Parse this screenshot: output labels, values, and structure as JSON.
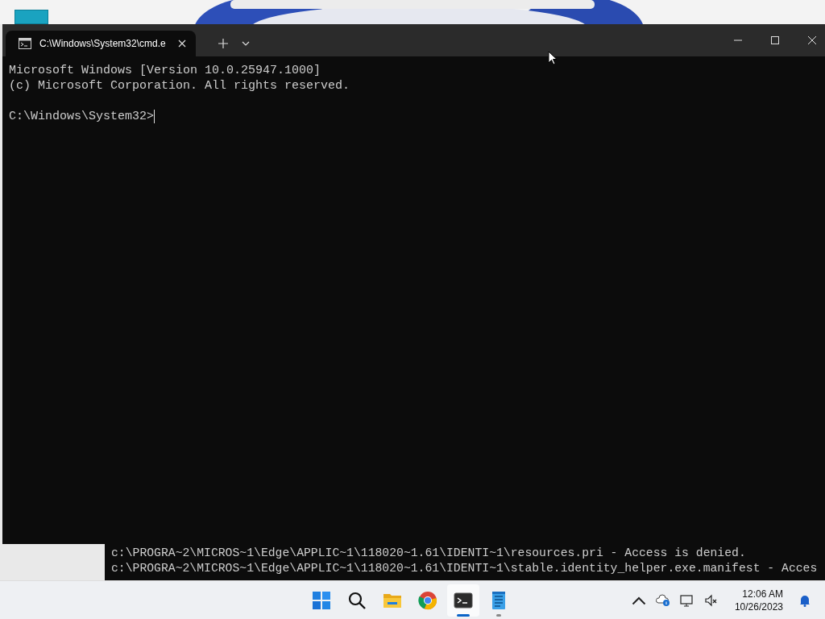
{
  "terminal_window": {
    "tab": {
      "title": "C:\\Windows\\System32\\cmd.e",
      "selected": true
    },
    "lines": [
      "Microsoft Windows [Version 10.0.25947.1000]",
      "(c) Microsoft Corporation. All rights reserved."
    ],
    "prompt": "C:\\Windows\\System32>"
  },
  "background_console": {
    "lines": [
      "c:\\PROGRA~2\\MICROS~1\\Edge\\APPLIC~1\\118020~1.61\\IDENTI~1\\resources.pri - Access is denied.",
      "c:\\PROGRA~2\\MICROS~1\\Edge\\APPLIC~1\\118020~1.61\\IDENTI~1\\stable.identity_helper.exe.manifest - Acces"
    ]
  },
  "taskbar": {
    "apps": [
      {
        "kind": "start",
        "active": false,
        "running": false
      },
      {
        "kind": "search",
        "active": false,
        "running": false
      },
      {
        "kind": "files",
        "active": false,
        "running": false
      },
      {
        "kind": "browser",
        "active": false,
        "running": false
      },
      {
        "kind": "terminal",
        "active": true,
        "running": true
      },
      {
        "kind": "notepad",
        "active": false,
        "running": true
      }
    ],
    "time": "12:06 AM",
    "date": "10/26/2023"
  }
}
